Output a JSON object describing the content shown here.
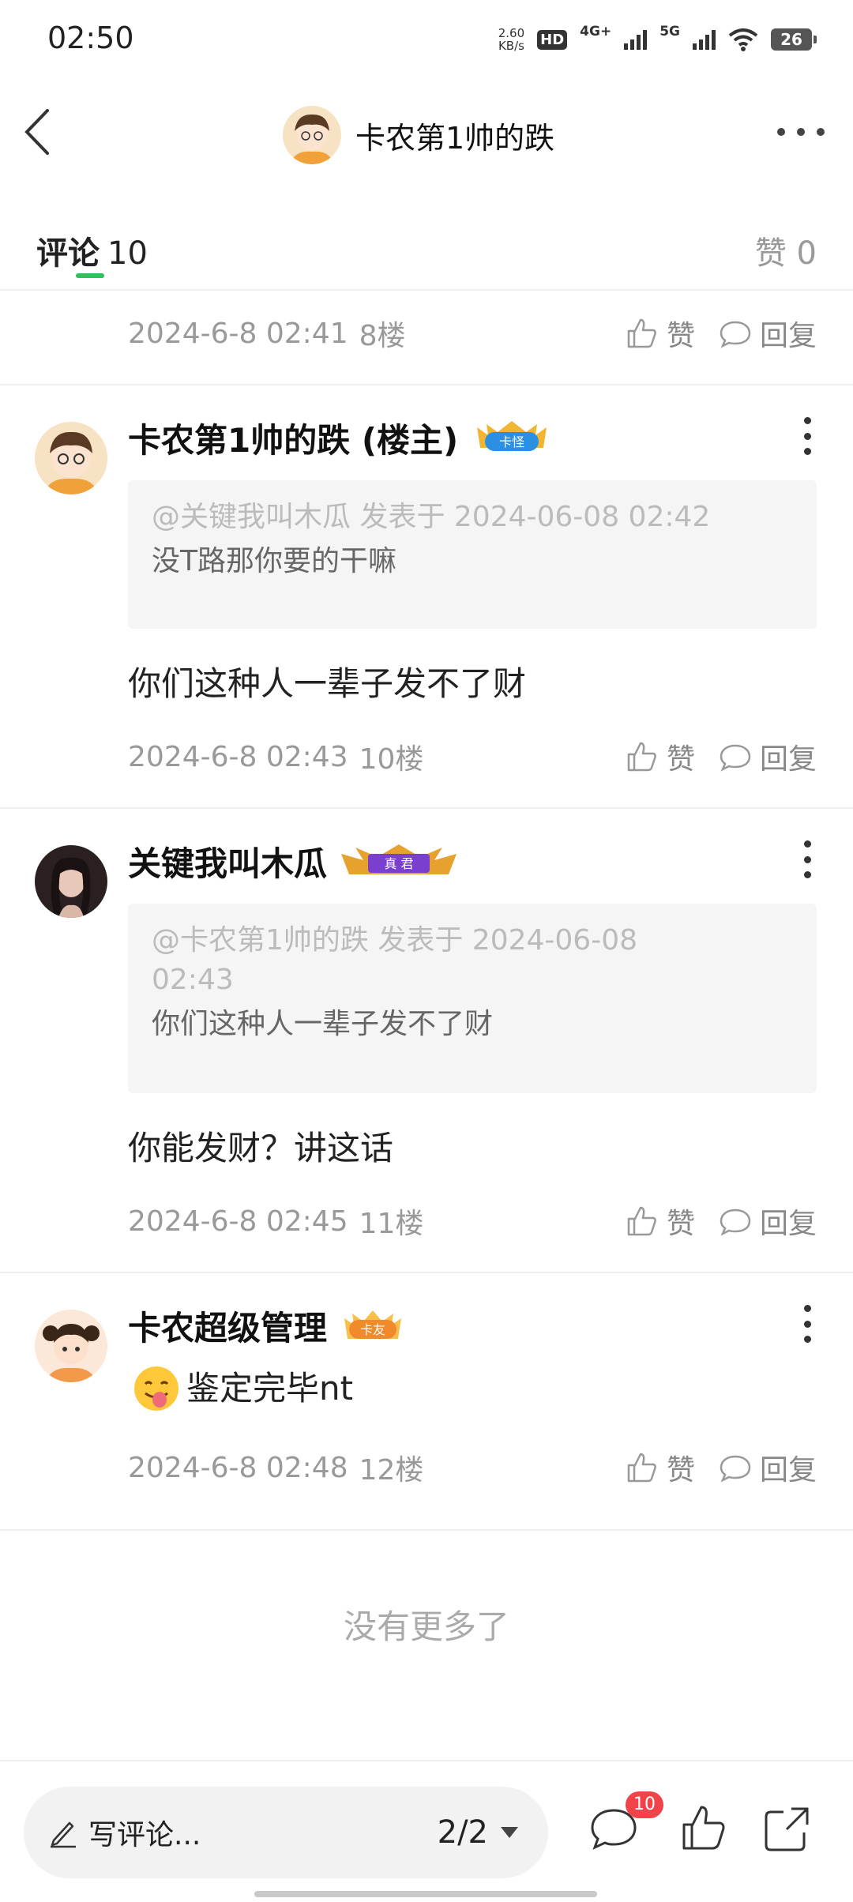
{
  "status_bar": {
    "time": "02:50",
    "speed_value": "2.60",
    "speed_unit": "KB/s",
    "hd_label": "HD",
    "network_4g": "4G+",
    "network_5g": "5G",
    "battery": "26"
  },
  "header": {
    "title": "卡农第1帅的跌"
  },
  "tabs": {
    "comments_label": "评论",
    "comments_count": "10",
    "likes_label": "赞",
    "likes_count": "0"
  },
  "actions": {
    "like_label": "赞",
    "reply_label": "回复"
  },
  "top_partial": {
    "date": "2024-6-8 02:41",
    "floor": "8楼"
  },
  "comments": [
    {
      "name": "卡农第1帅的跌 (楼主)",
      "badge": "卡怪",
      "quote_header": "@关键我叫木瓜 发表于 2024-06-08 02:42",
      "quote_text": "没T路那你要的干嘛",
      "body": "你们这种人一辈子发不了财",
      "date": "2024-6-8 02:43",
      "floor": "10楼"
    },
    {
      "name": "关键我叫木瓜",
      "badge": "真 君",
      "quote_header_line1": "@卡农第1帅的跌 发表于 2024-06-08",
      "quote_header_line2": "02:43",
      "quote_text": "你们这种人一辈子发不了财",
      "body": "你能发财？讲这话",
      "date": "2024-6-8 02:45",
      "floor": "11楼"
    },
    {
      "name": "卡农超级管理",
      "badge": "卡友",
      "body": "鉴定完毕nt",
      "date": "2024-6-8 02:48",
      "floor": "12楼"
    }
  ],
  "footer_text": "没有更多了",
  "bottom_bar": {
    "write_placeholder": "写评论...",
    "page_indicator": "2/2",
    "comment_badge": "10"
  },
  "colors": {
    "accent_green": "#2ec05a",
    "notification_red": "#f0444a"
  }
}
